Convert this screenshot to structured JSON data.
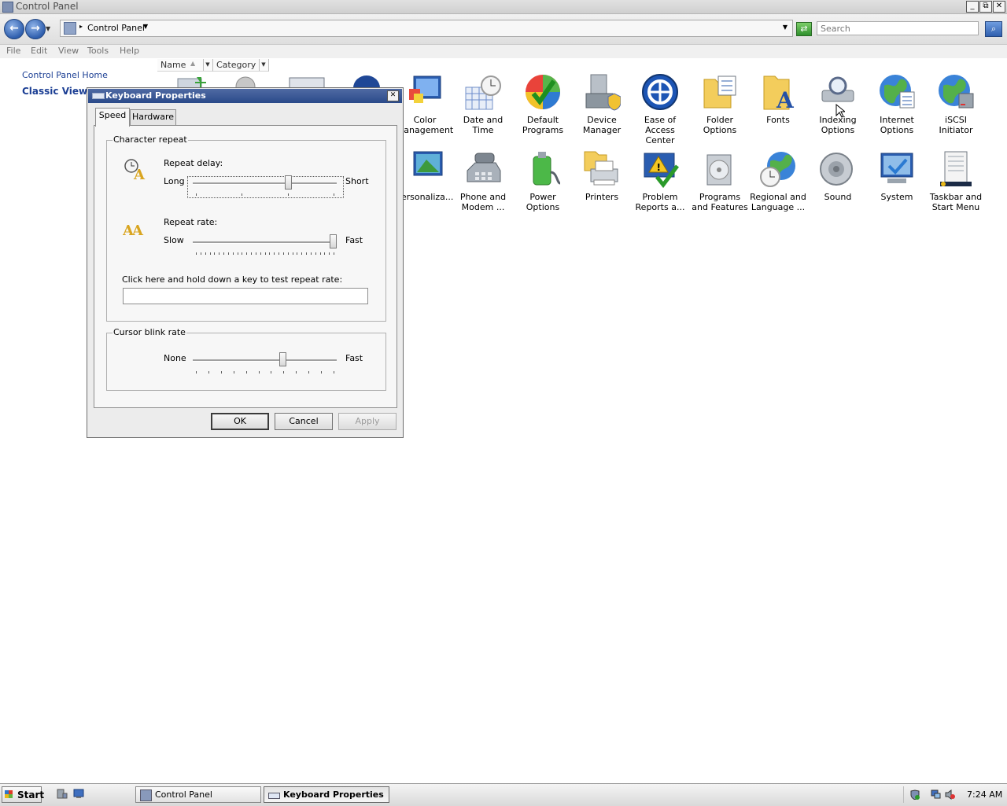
{
  "window": {
    "title": "Control Panel",
    "controls": [
      "_",
      "⧉",
      "✕"
    ]
  },
  "address": {
    "back_label": "←",
    "forward_label": "→",
    "breadcrumb": "Control Panel",
    "search_placeholder": "Search",
    "refresh_label": "⇄",
    "search_button_label": "⌕"
  },
  "menu": {
    "items": [
      "File",
      "Edit",
      "View",
      "Tools",
      "Help"
    ]
  },
  "left_nav": {
    "home_link": "Control Panel Home",
    "classic_view": "Classic View"
  },
  "columns": {
    "name": "Name",
    "category": "Category"
  },
  "cp_items": [
    {
      "label": "Color Management",
      "icon": "color-management-icon"
    },
    {
      "label": "Date and Time",
      "icon": "date-time-icon"
    },
    {
      "label": "Default Programs",
      "icon": "default-programs-icon"
    },
    {
      "label": "Device Manager",
      "icon": "device-manager-icon"
    },
    {
      "label": "Ease of Access Center",
      "icon": "ease-of-access-icon"
    },
    {
      "label": "Folder Options",
      "icon": "folder-options-icon"
    },
    {
      "label": "Fonts",
      "icon": "fonts-icon"
    },
    {
      "label": "Indexing Options",
      "icon": "indexing-options-icon"
    },
    {
      "label": "Internet Options",
      "icon": "internet-options-icon"
    },
    {
      "label": "iSCSI Initiator",
      "icon": "iscsi-initiator-icon"
    },
    {
      "label": "Personaliza...",
      "icon": "personalization-icon"
    },
    {
      "label": "Phone and Modem ...",
      "icon": "phone-modem-icon"
    },
    {
      "label": "Power Options",
      "icon": "power-options-icon"
    },
    {
      "label": "Printers",
      "icon": "printers-icon"
    },
    {
      "label": "Problem Reports a...",
      "icon": "problem-reports-icon"
    },
    {
      "label": "Programs and Features",
      "icon": "programs-features-icon"
    },
    {
      "label": "Regional and Language ...",
      "icon": "regional-language-icon"
    },
    {
      "label": "Sound",
      "icon": "sound-icon"
    },
    {
      "label": "System",
      "icon": "system-icon"
    },
    {
      "label": "Taskbar and Start Menu",
      "icon": "taskbar-start-menu-icon"
    }
  ],
  "dialog": {
    "title": "Keyboard Properties",
    "close_label": "✕",
    "tabs": [
      "Speed",
      "Hardware"
    ],
    "character_repeat": {
      "legend": "Character repeat",
      "repeat_delay_label": "Repeat delay:",
      "delay_min": "Long",
      "delay_max": "Short",
      "delay_value": 0.67,
      "repeat_rate_label": "Repeat rate:",
      "rate_min": "Slow",
      "rate_max": "Fast",
      "rate_value": 1.0,
      "test_label": "Click here and hold down a key to test repeat rate:",
      "test_value": ""
    },
    "cursor_blink": {
      "legend": "Cursor blink rate",
      "min": "None",
      "max": "Fast",
      "value": 0.63
    },
    "buttons": {
      "ok": "OK",
      "cancel": "Cancel",
      "apply": "Apply"
    }
  },
  "taskbar": {
    "start_label": "Start",
    "tasks": [
      "Control Panel",
      "Keyboard Properties"
    ],
    "clock": "7:24 AM"
  }
}
